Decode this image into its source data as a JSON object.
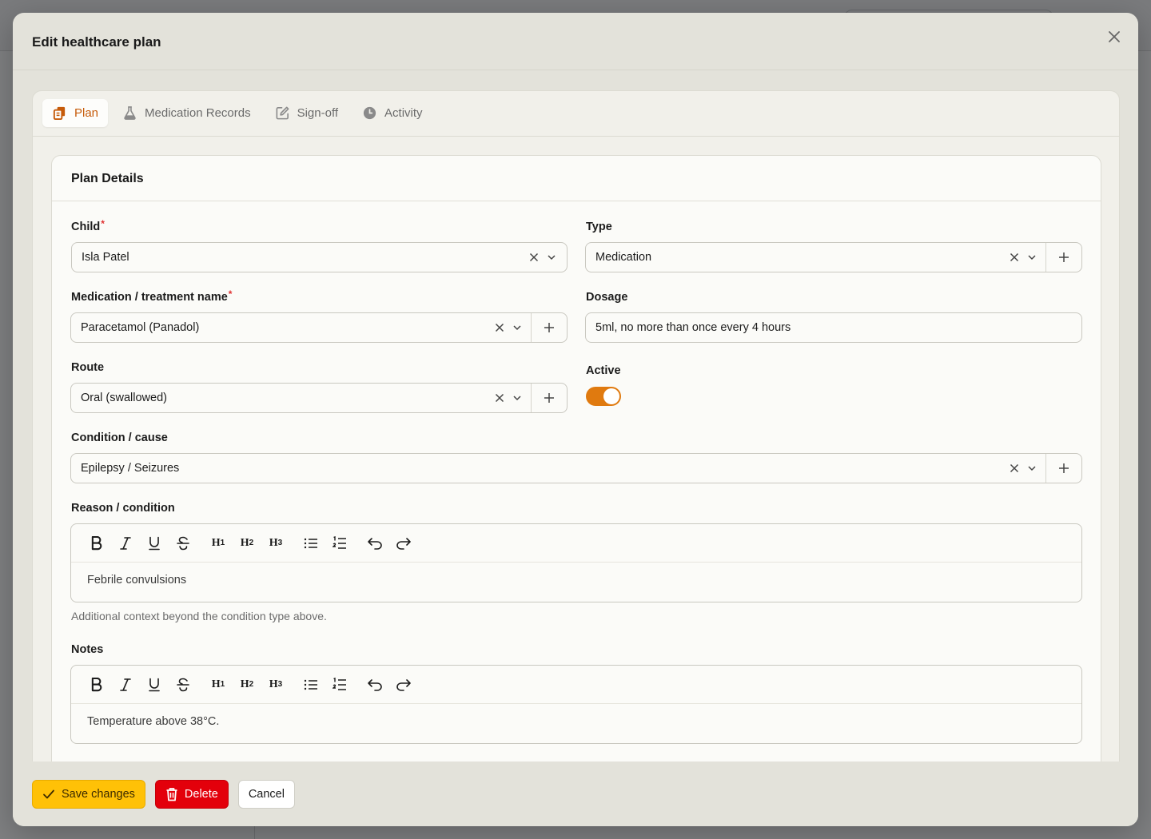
{
  "modal": {
    "title": "Edit healthcare plan"
  },
  "tabs": [
    {
      "label": "Plan",
      "icon": "documents-icon",
      "active": true
    },
    {
      "label": "Medication Records",
      "icon": "flask-icon",
      "active": false
    },
    {
      "label": "Sign-off",
      "icon": "edit-icon",
      "active": false
    },
    {
      "label": "Activity",
      "icon": "clock-icon",
      "active": false
    }
  ],
  "card": {
    "title": "Plan Details"
  },
  "fields": {
    "child": {
      "label": "Child",
      "value": "Isla Patel",
      "required": "*"
    },
    "type": {
      "label": "Type",
      "value": "Medication"
    },
    "medication": {
      "label": "Medication / treatment name",
      "value": "Paracetamol (Panadol)",
      "required": "*"
    },
    "dosage": {
      "label": "Dosage",
      "value": "5ml, no more than once every 4 hours"
    },
    "route": {
      "label": "Route",
      "value": "Oral (swallowed)"
    },
    "active": {
      "label": "Active",
      "on": true
    },
    "condition": {
      "label": "Condition / cause",
      "value": "Epilepsy / Seizures"
    },
    "reason": {
      "label": "Reason / condition",
      "content": "Febrile convulsions",
      "hint": "Additional context beyond the condition type above."
    },
    "notes": {
      "label": "Notes",
      "content": "Temperature above 38°C."
    }
  },
  "toolbar": {
    "h1": "H",
    "h2": "H",
    "h3": "H",
    "n1": "1",
    "n2": "2",
    "n3": "3"
  },
  "footer": {
    "save_label": "Save changes",
    "delete_label": "Delete",
    "cancel_label": "Cancel"
  },
  "colors": {
    "accent": "#e07a0f",
    "active_tab": "#c65b0a",
    "save": "#ffc107",
    "delete": "#e3000b"
  }
}
